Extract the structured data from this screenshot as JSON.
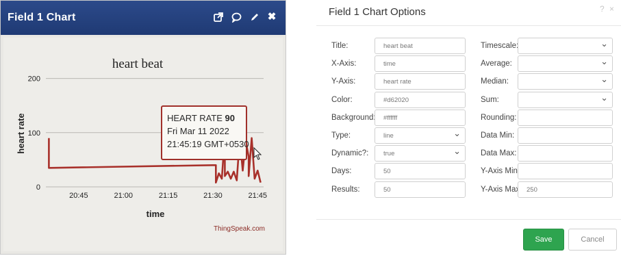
{
  "widget": {
    "title": "Field 1 Chart",
    "icons": [
      "external-link-icon",
      "comment-icon",
      "pencil-icon",
      "close-icon"
    ]
  },
  "chart_data": {
    "type": "line",
    "title": "heart beat",
    "xlabel": "time",
    "ylabel": "heart rate",
    "color": "#a8302a",
    "yticks": [
      0,
      100,
      200
    ],
    "xticks": [
      "20:45",
      "21:00",
      "21:15",
      "21:30",
      "21:45"
    ],
    "ylim": [
      0,
      250
    ],
    "grid": true,
    "credit": "ThingSpeak.com",
    "series": [
      {
        "points": [
          {
            "x": "20:35",
            "y": 90
          },
          {
            "x": "20:35",
            "y": 35
          },
          {
            "x": "21:30",
            "y": 40
          },
          {
            "x": "21:31",
            "y": 40
          },
          {
            "x": "21:31",
            "y": 8
          },
          {
            "x": "21:32",
            "y": 25
          },
          {
            "x": "21:33",
            "y": 15
          },
          {
            "x": "21:34",
            "y": 95
          },
          {
            "x": "21:34",
            "y": 20
          },
          {
            "x": "21:35",
            "y": 28
          },
          {
            "x": "21:36",
            "y": 15
          },
          {
            "x": "21:37",
            "y": 28
          },
          {
            "x": "21:38",
            "y": 12
          },
          {
            "x": "21:39",
            "y": 90
          },
          {
            "x": "21:40",
            "y": 30
          },
          {
            "x": "21:41",
            "y": 85
          },
          {
            "x": "21:42",
            "y": 55
          },
          {
            "x": "21:42",
            "y": 20
          },
          {
            "x": "21:43",
            "y": 90
          },
          {
            "x": "21:44",
            "y": 15
          },
          {
            "x": "21:45",
            "y": 30
          },
          {
            "x": "21:46",
            "y": 8
          }
        ]
      }
    ],
    "tooltip": {
      "label": "HEART RATE",
      "value": "90",
      "date": "Fri Mar 11 2022",
      "time": "21:45:19 GMT+0530"
    }
  },
  "options": {
    "title": "Field 1 Chart Options",
    "help": "? ×",
    "left": [
      {
        "label": "Title:",
        "value": "heart beat",
        "kind": "text"
      },
      {
        "label": "X-Axis:",
        "value": "time",
        "kind": "text"
      },
      {
        "label": "Y-Axis:",
        "value": "heart rate",
        "kind": "text"
      },
      {
        "label": "Color:",
        "value": "#d62020",
        "kind": "text"
      },
      {
        "label": "Background:",
        "value": "#ffffff",
        "kind": "text"
      },
      {
        "label": "Type:",
        "value": "line",
        "kind": "select"
      },
      {
        "label": "Dynamic?:",
        "value": "true",
        "kind": "select"
      },
      {
        "label": "Days:",
        "value": "50",
        "kind": "text"
      },
      {
        "label": "Results:",
        "value": "50",
        "kind": "text"
      }
    ],
    "right": [
      {
        "label": "Timescale:",
        "value": "",
        "kind": "select"
      },
      {
        "label": "Average:",
        "value": "",
        "kind": "select"
      },
      {
        "label": "Median:",
        "value": "",
        "kind": "select"
      },
      {
        "label": "Sum:",
        "value": "",
        "kind": "select"
      },
      {
        "label": "Rounding:",
        "value": "",
        "kind": "text"
      },
      {
        "label": "Data Min:",
        "value": "",
        "kind": "text"
      },
      {
        "label": "Data Max:",
        "value": "",
        "kind": "text"
      },
      {
        "label": "Y-Axis Min:",
        "value": "",
        "kind": "text"
      },
      {
        "label": "Y-Axis Max:",
        "value": "250",
        "kind": "text"
      }
    ],
    "save_label": "Save",
    "cancel_label": "Cancel"
  }
}
